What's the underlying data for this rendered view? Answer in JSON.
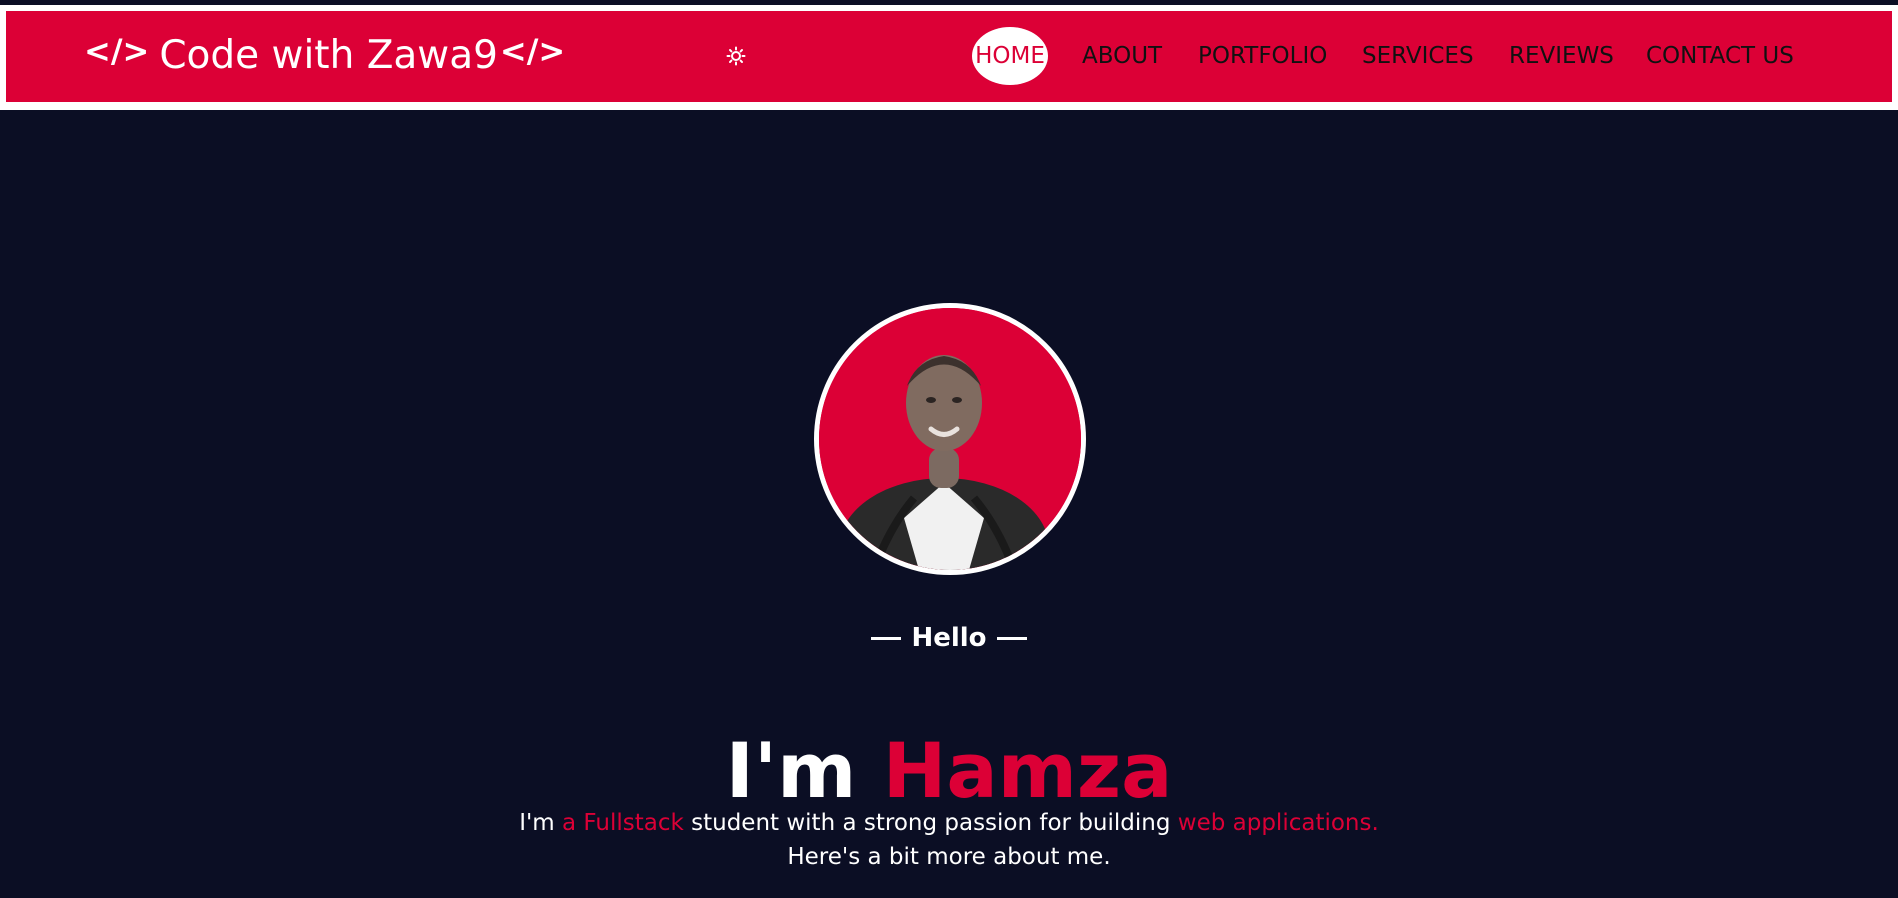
{
  "colors": {
    "background": "#0b0e24",
    "accent": "#dc0036",
    "navbar": "#dc0036",
    "text": "#ffffff",
    "nav_text": "#111111"
  },
  "header": {
    "brand_prefix_icon": "code-icon",
    "brand_text": "Code with Zawa9",
    "theme_toggle_icon": "sun-icon",
    "nav": {
      "home": "HOME",
      "about": "ABOUT",
      "portfolio": "PORTFOLIO",
      "services": "SERVICES",
      "reviews": "REVIEWS",
      "contact": "CONTACT US"
    }
  },
  "hero": {
    "avatar_icon": "profile-photo",
    "hello": "Hello",
    "headline_prefix": "I'm",
    "headline_name": "Hamza",
    "intro": {
      "part1": "I'm",
      "part2": "a Fullstack",
      "part3": "student with a strong passion for building",
      "part4": "web applications.",
      "line2": "Here's a bit more about me."
    }
  }
}
